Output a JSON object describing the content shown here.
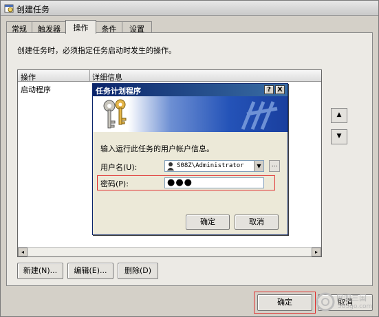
{
  "window": {
    "title": "创建任务"
  },
  "tabs": [
    "常规",
    "触发器",
    "操作",
    "条件",
    "设置"
  ],
  "active_tab": "操作",
  "panel": {
    "hint": "创建任务时，必须指定任务启动时发生的操作。",
    "columns": [
      "操作",
      "详细信息"
    ],
    "rows": [
      {
        "action": "启动程序",
        "details": ""
      }
    ],
    "buttons": {
      "new": "新建(N)...",
      "edit": "编辑(E)...",
      "delete": "删除(D)"
    }
  },
  "footer": {
    "ok": "确定",
    "cancel": "取消"
  },
  "dialog": {
    "title": "任务计划程序",
    "help_btn": "?",
    "close_btn": "X",
    "prompt": "输入运行此任务的用户帐户信息。",
    "username_label": "用户名(U):",
    "username_value": "S08Z\\Administrator",
    "password_label": "密码(P):",
    "password_value": "●●●",
    "browse_label": "...",
    "ok": "确定",
    "cancel": "取消"
  },
  "watermark": {
    "line1": "网吧三国",
    "line2": "583go.com"
  },
  "colors": {
    "highlight": "#e03030",
    "dialog_title": "#0a246a",
    "banner_blue": "#2453b8"
  },
  "icons": [
    "task-icon",
    "keys-icon",
    "user-icon",
    "scroll-up-icon",
    "scroll-down-icon",
    "chevron-down-icon"
  ]
}
